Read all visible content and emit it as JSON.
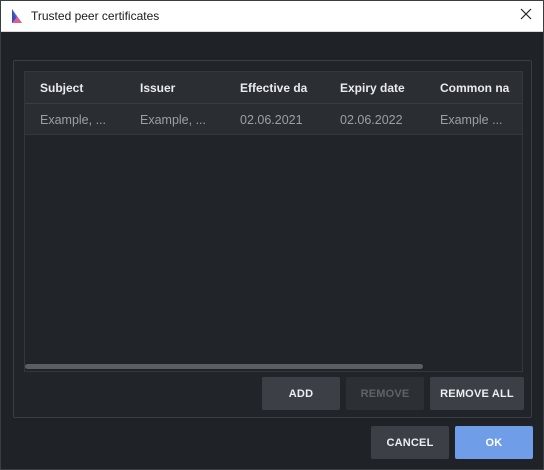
{
  "window": {
    "title": "Trusted peer certificates",
    "close_icon": "close-icon",
    "app_icon": "app-logo-icon"
  },
  "table": {
    "columns": [
      "Subject",
      "Issuer",
      "Effective da",
      "Expiry date",
      "Common na"
    ],
    "rows": [
      [
        "Example, ...",
        "Example, ...",
        "02.06.2021",
        "02.06.2022",
        "Example ..."
      ]
    ]
  },
  "actions": {
    "add_label": "ADD",
    "remove_label": "REMOVE",
    "remove_all_label": "REMOVE ALL"
  },
  "footer": {
    "cancel_label": "CANCEL",
    "ok_label": "OK"
  },
  "colors": {
    "accent": "#6f9de8",
    "background": "#1f2226",
    "button": "#3c4046",
    "button_disabled_text": "#5f6368"
  }
}
